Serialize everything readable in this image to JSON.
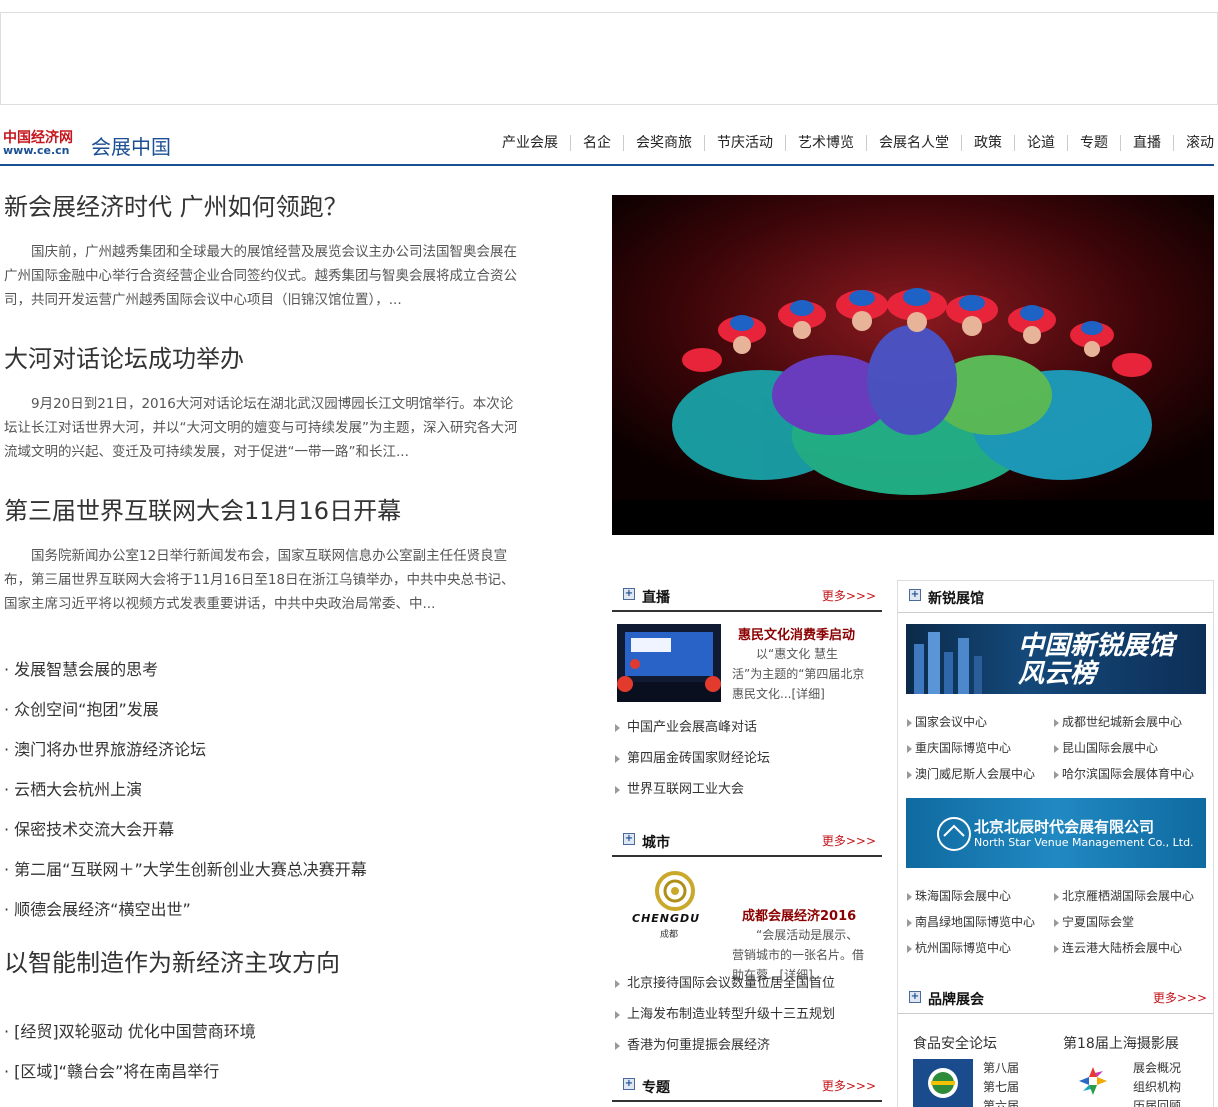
{
  "header": {
    "logo_cn": "中国经济网",
    "logo_url": "www.ce.cn",
    "site_name": "会展中国",
    "nav": [
      "产业会展",
      "名企",
      "会奖商旅",
      "节庆活动",
      "艺术博览",
      "会展名人堂",
      "政策",
      "论道",
      "专题",
      "直播",
      "滚动"
    ]
  },
  "stories": [
    {
      "title": "新会展经济时代 广州如何领跑？",
      "summary": "国庆前，广州越秀集团和全球最大的展馆经营及展览会议主办公司法国智奥会展在广州国际金融中心举行合资经营企业合同签约仪式。越秀集团与智奥会展将成立合资公司，共同开发运营广州越秀国际会议中心项目（旧锦汉馆位置），..."
    },
    {
      "title": "大河对话论坛成功举办",
      "summary": "9月20日到21日，2016大河对话论坛在湖北武汉园博园长江文明馆举行。本次论坛让长江对话世界大河，并以“大河文明的嬗变与可持续发展”为主题，深入研究各大河流域文明的兴起、变迁及可持续发展，对于促进“一带一路”和长江..."
    },
    {
      "title": "第三届世界互联网大会11月16日开幕",
      "summary": "国务院新闻办公室12日举行新闻发布会，国家互联网信息办公室副主任任贤良宣布，第三届世界互联网大会将于11月16日至18日在浙江乌镇举办，中共中央总书记、国家主席习近平将以视频方式发表重要讲话，中共中央政治局常委、中..."
    }
  ],
  "bullets": [
    "· 发展智慧会展的思考",
    "· 众创空间“抱团”发展",
    "· 澳门将办世界旅游经济论坛",
    "· 云栖大会杭州上演",
    "· 保密技术交流大会开幕",
    "· 第二届“互联网＋”大学生创新创业大赛总决赛开幕",
    "· 顺德会展经济“横空出世”"
  ],
  "section2": {
    "title": "以智能制造作为新经济主攻方向",
    "bullets": [
      "· [经贸]双轮驱动 优化中国营商环境",
      "· [区域]“赣台会”将在南昌举行"
    ]
  },
  "live": {
    "title": "直播",
    "more": "更多>>>",
    "feature_title": "惠民文化消费季启动",
    "feature_desc": "以“惠文化 慧生活”为主题的“第四届北京惠民文化...[详细]",
    "links": [
      "中国产业会展高峰对话",
      "第四届金砖国家财经论坛",
      "世界互联网工业大会"
    ]
  },
  "city": {
    "title": "城市",
    "more": "更多>>>",
    "feature_title": "成都会展经济2016",
    "feature_desc": "“会展活动是展示、营销城市的一张名片。借助在蓉...[详细]",
    "logo_text": "CHENGDU",
    "logo_cn": "成都",
    "links": [
      "北京接待国际会议数量位居全国首位",
      "上海发布制造业转型升级十三五规划",
      "香港为何重提振会展经济"
    ]
  },
  "topic": {
    "title": "专题",
    "more": "更多>>>"
  },
  "venues": {
    "title": "新锐展馆",
    "banner1": "中国新锐展馆风云榜",
    "list1": [
      "国家会议中心",
      "成都世纪城新会展中心",
      "重庆国际博览中心",
      "昆山国际会展中心",
      "澳门威尼斯人会展中心",
      "哈尔滨国际会展体育中心"
    ],
    "banner2_cn": "北京北辰时代会展有限公司",
    "banner2_en": "North Star Venue Management Co., Ltd.",
    "list2": [
      "珠海国际会展中心",
      "北京雁栖湖国际会展中心",
      "南昌绿地国际博览中心",
      "宁夏国际会堂",
      "杭州国际博览中心",
      "连云港大陆桥会展中心"
    ]
  },
  "brand": {
    "title": "品牌展会",
    "more": "更多>>>",
    "show1": {
      "name": "食品安全论坛",
      "items": [
        "第八届",
        "第七届",
        "第六届"
      ]
    },
    "show2": {
      "name": "第18届上海摄影展",
      "items": [
        "展会概况",
        "组织机构",
        "历届回顾"
      ]
    }
  }
}
